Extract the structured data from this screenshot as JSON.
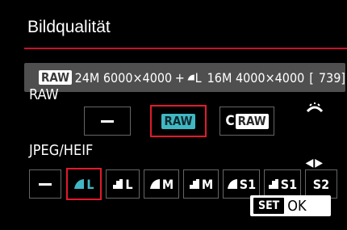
{
  "header": {
    "title": "Bildqualität"
  },
  "summary": {
    "raw_badge": "RAW",
    "raw_size": "24M 6000×4000",
    "plus": "+",
    "jpeg_size_letter": "L",
    "jpeg_size": "16M 4000×4000",
    "shots_open": "[",
    "shots_count": "739",
    "shots_close": "]"
  },
  "raw_section": {
    "label": "RAW",
    "options": [
      {
        "id": "off",
        "label": ""
      },
      {
        "id": "raw",
        "label": "RAW"
      },
      {
        "id": "craw_c",
        "label": "C"
      },
      {
        "id": "craw_raw",
        "label": "RAW"
      }
    ],
    "selected": "raw"
  },
  "jpeg_section": {
    "label": "JPEG/HEIF",
    "options": [
      {
        "id": "off",
        "label": ""
      },
      {
        "id": "l_fine",
        "label": "L"
      },
      {
        "id": "l_normal",
        "label": "L"
      },
      {
        "id": "m_fine",
        "label": "M"
      },
      {
        "id": "m_normal",
        "label": "M"
      },
      {
        "id": "s1_fine",
        "label": "S1"
      },
      {
        "id": "s1_normal",
        "label": "S1"
      },
      {
        "id": "s2",
        "label": "S2"
      }
    ],
    "selected": "l_fine"
  },
  "footer": {
    "set_label": "SET",
    "ok_label": "OK"
  },
  "colors": {
    "accent": "#c8102e",
    "teal": "#41b7c4",
    "summary_bg": "#4f4f4f"
  }
}
